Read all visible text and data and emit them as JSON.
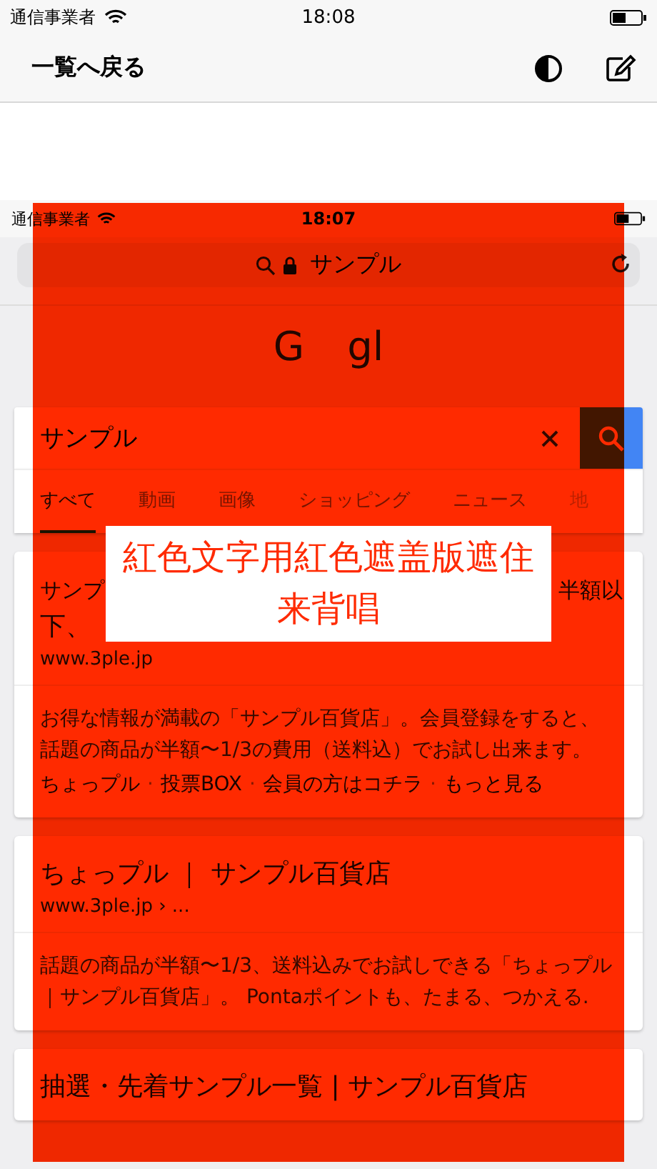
{
  "status_bar": {
    "carrier": "通信事業者",
    "time": "18:08"
  },
  "nav": {
    "back": "一覧へ戻る"
  },
  "screenshot": {
    "status_bar": {
      "carrier": "通信事業者",
      "time": "18:07"
    },
    "address_bar": {
      "text": "サンプル"
    },
    "logo": [
      "G",
      "gl"
    ],
    "search": {
      "value": "サンプル"
    },
    "tabs": [
      {
        "label": "すべて",
        "selected": true
      },
      {
        "label": "動画",
        "selected": false
      },
      {
        "label": "画像",
        "selected": false
      },
      {
        "label": "ショッピング",
        "selected": false
      },
      {
        "label": "ニュース",
        "selected": false
      },
      {
        "label": "地",
        "selected": false
      }
    ],
    "results": [
      {
        "title_fragments": [
          "サンプ",
          "半額以",
          "下、"
        ],
        "url": "www.3ple.jp",
        "snippet": "お得な情報が満載の「サンプル百貨店」。会員登録をすると、話題の商品が半額〜1/3の費用（送料込）でお試し出来ます。",
        "links": [
          "ちょっプル",
          "投票BOX",
          "会員の方はコチラ",
          "もっと見る"
        ],
        "link_separator": "·"
      },
      {
        "title": "ちょっプル ｜ サンプル百貨店",
        "url": "www.3ple.jp › ...",
        "snippet": "話題の商品が半額〜1/3、送料込みでお試しできる「ちょっプル｜サンプル百貨店」。 Pontaポイントも、たまる、つかえる."
      },
      {
        "title": "抽選・先着サンプル一覧 | サンプル百貨店"
      }
    ]
  },
  "overlay": {
    "label": "紅色文字用紅色遮盖版遮住来背唱"
  }
}
